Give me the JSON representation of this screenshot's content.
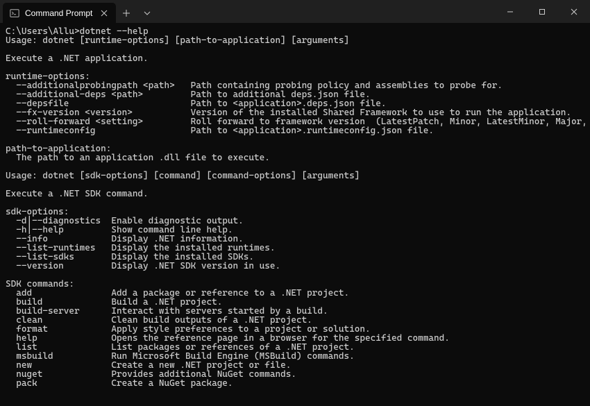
{
  "window": {
    "tab_title": "Command Prompt"
  },
  "terminal": {
    "prompt": "C:\\Users\\Allu>dotnet --help",
    "usage_runtime": "Usage: dotnet [runtime-options] [path-to-application] [arguments]",
    "exec_app": "Execute a .NET application.",
    "runtime_options_header": "runtime-options:",
    "runtime_options": [
      {
        "flag": "  --additionalprobingpath <path>   ",
        "desc": "Path containing probing policy and assemblies to probe for."
      },
      {
        "flag": "  --additional-deps <path>         ",
        "desc": "Path to additional deps.json file."
      },
      {
        "flag": "  --depsfile                       ",
        "desc": "Path to <application>.deps.json file."
      },
      {
        "flag": "  --fx-version <version>           ",
        "desc": "Version of the installed Shared Framework to use to run the application."
      },
      {
        "flag": "  --roll-forward <setting>         ",
        "desc": "Roll forward to framework version  (LatestPatch, Minor, LatestMinor, Major, LatestMajor, Disable)."
      },
      {
        "flag": "  --runtimeconfig                  ",
        "desc": "Path to <application>.runtimeconfig.json file."
      }
    ],
    "path_header": "path-to-application:",
    "path_desc": "  The path to an application .dll file to execute.",
    "usage_sdk": "Usage: dotnet [sdk-options] [command] [command-options] [arguments]",
    "exec_sdk": "Execute a .NET SDK command.",
    "sdk_options_header": "sdk-options:",
    "sdk_options": [
      {
        "flag": "  -d|--diagnostics  ",
        "desc": "Enable diagnostic output."
      },
      {
        "flag": "  -h|--help         ",
        "desc": "Show command line help."
      },
      {
        "flag": "  --info            ",
        "desc": "Display .NET information."
      },
      {
        "flag": "  --list-runtimes   ",
        "desc": "Display the installed runtimes."
      },
      {
        "flag": "  --list-sdks       ",
        "desc": "Display the installed SDKs."
      },
      {
        "flag": "  --version         ",
        "desc": "Display .NET SDK version in use."
      }
    ],
    "sdk_commands_header": "SDK commands:",
    "sdk_commands": [
      {
        "cmd": "  add               ",
        "desc": "Add a package or reference to a .NET project."
      },
      {
        "cmd": "  build             ",
        "desc": "Build a .NET project."
      },
      {
        "cmd": "  build-server      ",
        "desc": "Interact with servers started by a build."
      },
      {
        "cmd": "  clean             ",
        "desc": "Clean build outputs of a .NET project."
      },
      {
        "cmd": "  format            ",
        "desc": "Apply style preferences to a project or solution."
      },
      {
        "cmd": "  help              ",
        "desc": "Opens the reference page in a browser for the specified command."
      },
      {
        "cmd": "  list              ",
        "desc": "List packages or references of a .NET project."
      },
      {
        "cmd": "  msbuild           ",
        "desc": "Run Microsoft Build Engine (MSBuild) commands."
      },
      {
        "cmd": "  new               ",
        "desc": "Create a new .NET project or file."
      },
      {
        "cmd": "  nuget             ",
        "desc": "Provides additional NuGet commands."
      },
      {
        "cmd": "  pack              ",
        "desc": "Create a NuGet package."
      }
    ]
  }
}
